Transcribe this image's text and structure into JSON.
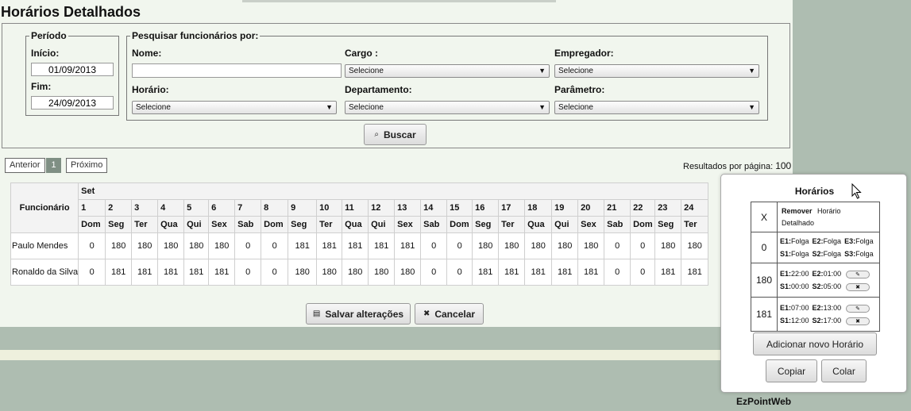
{
  "page": {
    "title": "Horários Detalhados"
  },
  "periodo": {
    "legend": "Período",
    "inicio_label": "Início:",
    "inicio_value": "01/09/2013",
    "fim_label": "Fim:",
    "fim_value": "24/09/2013"
  },
  "pesquisa": {
    "legend": "Pesquisar funcionários por:",
    "nome_label": "Nome:",
    "nome_value": "",
    "cargo_label": "Cargo :",
    "cargo_value": "Selecione",
    "empregador_label": "Empregador:",
    "empregador_value": "Selecione",
    "horario_label": "Horário:",
    "horario_value": "Selecione",
    "departamento_label": "Departamento:",
    "departamento_value": "Selecione",
    "parametro_label": "Parâmetro:",
    "parametro_value": "Selecione",
    "buscar_label": "Buscar"
  },
  "pager": {
    "prev": "Anterior",
    "current": "1",
    "next": "Próximo",
    "per_page_label": "Resultados por página:",
    "per_page_value": "100"
  },
  "grid": {
    "func_header": "Funcionário",
    "month": "Set",
    "days": [
      "1",
      "2",
      "3",
      "4",
      "5",
      "6",
      "7",
      "8",
      "9",
      "10",
      "11",
      "12",
      "13",
      "14",
      "15",
      "16",
      "17",
      "18",
      "19",
      "20",
      "21",
      "22",
      "23",
      "24"
    ],
    "weekdays": [
      "Dom",
      "Seg",
      "Ter",
      "Qua",
      "Qui",
      "Sex",
      "Sab",
      "Dom",
      "Seg",
      "Ter",
      "Qua",
      "Qui",
      "Sex",
      "Sab",
      "Dom",
      "Seg",
      "Ter",
      "Qua",
      "Qui",
      "Sex",
      "Sab",
      "Dom",
      "Seg",
      "Ter"
    ],
    "rows": [
      {
        "name": "Paulo Mendes",
        "values": [
          "0",
          "180",
          "180",
          "180",
          "180",
          "180",
          "0",
          "0",
          "181",
          "181",
          "181",
          "181",
          "181",
          "0",
          "0",
          "180",
          "180",
          "180",
          "180",
          "180",
          "0",
          "0",
          "180",
          "180"
        ]
      },
      {
        "name": "Ronaldo da Silva",
        "values": [
          "0",
          "181",
          "181",
          "181",
          "181",
          "181",
          "0",
          "0",
          "180",
          "180",
          "180",
          "180",
          "180",
          "0",
          "0",
          "181",
          "181",
          "181",
          "181",
          "181",
          "0",
          "0",
          "181",
          "181"
        ]
      }
    ]
  },
  "actions": {
    "save": "Salvar alterações",
    "cancel": "Cancelar"
  },
  "popup": {
    "title": "Horários",
    "remove_code": "X",
    "remove_label": "Remover",
    "remove_desc": "Horário Detalhado",
    "entries": [
      {
        "code": "0",
        "line1": [
          [
            "E1:",
            "Folga"
          ],
          [
            "E2:",
            "Folga"
          ],
          [
            "E3:",
            "Folga"
          ]
        ],
        "line2": [
          [
            "S1:",
            "Folga"
          ],
          [
            "S2:",
            "Folga"
          ],
          [
            "S3:",
            "Folga"
          ]
        ],
        "editable": false
      },
      {
        "code": "180",
        "line1": [
          [
            "E1:",
            "22:00"
          ],
          [
            "E2:",
            "01:00"
          ]
        ],
        "line2": [
          [
            "S1:",
            "00:00"
          ],
          [
            "S2:",
            "05:00"
          ]
        ],
        "editable": true
      },
      {
        "code": "181",
        "line1": [
          [
            "E1:",
            "07:00"
          ],
          [
            "E2:",
            "13:00"
          ]
        ],
        "line2": [
          [
            "S1:",
            "12:00"
          ],
          [
            "S2:",
            "17:00"
          ]
        ],
        "editable": true
      }
    ],
    "add_label": "Adicionar novo Horário",
    "copy_label": "Copiar",
    "paste_label": "Colar"
  },
  "footer": {
    "brand": "EzPointWeb"
  }
}
